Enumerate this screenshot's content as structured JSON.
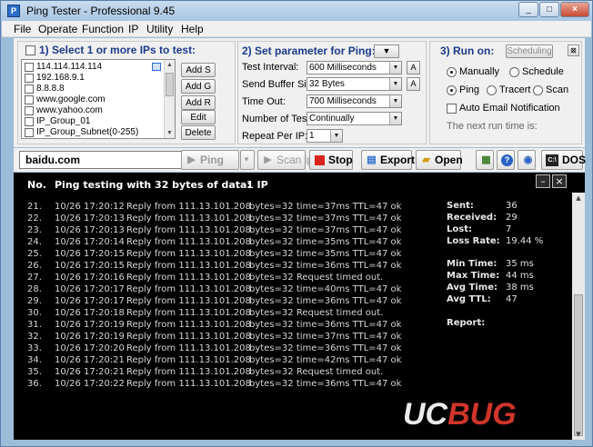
{
  "window": {
    "title": "Ping Tester - Professional  9.45",
    "minimize": "_",
    "maximize": "□",
    "close": "×"
  },
  "menu": [
    "File",
    "Operate",
    "Function",
    "IP",
    "Utility",
    "Help"
  ],
  "section1": {
    "title": "1) Select 1 or more IPs to test:",
    "items": [
      {
        "label": "114.114.114.114",
        "checked": false
      },
      {
        "label": "192.168.9.1",
        "checked": false
      },
      {
        "label": "8.8.8.8",
        "checked": false
      },
      {
        "label": "www.google.com",
        "checked": false
      },
      {
        "label": "www.yahoo.com",
        "checked": false
      },
      {
        "label": "IP_Group_01",
        "checked": false
      },
      {
        "label": "IP_Group_Subnet(0-255)",
        "checked": false
      }
    ],
    "buttons": [
      "Add S",
      "Add G",
      "Add R",
      "Edit",
      "Delete"
    ]
  },
  "section2": {
    "title": "2) Set parameter for Ping:",
    "fields": [
      {
        "label": "Test Interval:",
        "value": "600  Milliseconds",
        "has_a": true
      },
      {
        "label": "Send Buffer Size:",
        "value": "32  Bytes",
        "has_a": true
      },
      {
        "label": "Time Out:",
        "value": "700  Milliseconds",
        "has_a": false
      },
      {
        "label": "Number of Test:",
        "value": "Continually",
        "has_a": false
      },
      {
        "label": "Repeat Per IP:",
        "value": "1",
        "has_a": false
      }
    ],
    "a_label": "A"
  },
  "section3": {
    "title": "3) Run on:",
    "scheduling_label": "Scheduling",
    "run_options": [
      {
        "label": "Manually",
        "selected": true
      },
      {
        "label": "Schedule",
        "selected": false
      }
    ],
    "method_options": [
      {
        "label": "Ping",
        "selected": true
      },
      {
        "label": "Tracert",
        "selected": false
      },
      {
        "label": "Scan",
        "selected": false
      }
    ],
    "auto_email": "Auto Email Notification",
    "next_run": "The next run time is:"
  },
  "toolbar": {
    "target": "baidu.com",
    "ping": "Ping",
    "scan_ip": "Scan ip",
    "stop": "Stop",
    "export": "Export",
    "open": "Open",
    "dos": "DOS"
  },
  "console": {
    "header_no": "No.",
    "header_text": "Ping testing with 32 bytes of data:",
    "header_ip": "1  IP",
    "rows": [
      {
        "no": "21.",
        "time": "10/26 17:20:12",
        "from": "Reply from 111.13.101.208",
        "msg": "bytes=32  time=37ms  TTL=47  ok"
      },
      {
        "no": "22.",
        "time": "10/26 17:20:13",
        "from": "Reply from 111.13.101.208",
        "msg": "bytes=32  time=37ms  TTL=47  ok"
      },
      {
        "no": "23.",
        "time": "10/26 17:20:13",
        "from": "Reply from 111.13.101.208",
        "msg": "bytes=32  time=37ms  TTL=47  ok"
      },
      {
        "no": "24.",
        "time": "10/26 17:20:14",
        "from": "Reply from 111.13.101.208",
        "msg": "bytes=32  time=35ms  TTL=47  ok"
      },
      {
        "no": "25.",
        "time": "10/26 17:20:15",
        "from": "Reply from 111.13.101.208",
        "msg": "bytes=32  time=35ms  TTL=47  ok"
      },
      {
        "no": "26.",
        "time": "10/26 17:20:15",
        "from": "Reply from 111.13.101.208",
        "msg": "bytes=32  time=36ms  TTL=47  ok"
      },
      {
        "no": "27.",
        "time": "10/26 17:20:16",
        "from": "Reply from 111.13.101.208",
        "msg": "bytes=32  Request  timed  out."
      },
      {
        "no": "28.",
        "time": "10/26 17:20:17",
        "from": "Reply from 111.13.101.208",
        "msg": "bytes=32  time=40ms  TTL=47  ok"
      },
      {
        "no": "29.",
        "time": "10/26 17:20:17",
        "from": "Reply from 111.13.101.208",
        "msg": "bytes=32  time=36ms  TTL=47  ok"
      },
      {
        "no": "30.",
        "time": "10/26 17:20:18",
        "from": "Reply from 111.13.101.208",
        "msg": "bytes=32  Request  timed  out."
      },
      {
        "no": "31.",
        "time": "10/26 17:20:19",
        "from": "Reply from 111.13.101.208",
        "msg": "bytes=32  time=36ms  TTL=47  ok"
      },
      {
        "no": "32.",
        "time": "10/26 17:20:19",
        "from": "Reply from 111.13.101.208",
        "msg": "bytes=32  time=37ms  TTL=47  ok"
      },
      {
        "no": "33.",
        "time": "10/26 17:20:20",
        "from": "Reply from 111.13.101.208",
        "msg": "bytes=32  time=36ms  TTL=47  ok"
      },
      {
        "no": "34.",
        "time": "10/26 17:20:21",
        "from": "Reply from 111.13.101.208",
        "msg": "bytes=32  time=42ms  TTL=47  ok"
      },
      {
        "no": "35.",
        "time": "10/26 17:20:21",
        "from": "Reply from 111.13.101.208",
        "msg": "bytes=32  Request  timed  out."
      },
      {
        "no": "36.",
        "time": "10/26 17:20:22",
        "from": "Reply from 111.13.101.208",
        "msg": "bytes=32  time=36ms  TTL=47  ok"
      }
    ],
    "stats": [
      {
        "label": "Sent:",
        "value": "36"
      },
      {
        "label": "Received:",
        "value": "29"
      },
      {
        "label": "Lost:",
        "value": "7"
      },
      {
        "label": "Loss Rate:",
        "value": "19.44 %"
      },
      {
        "label": "Min Time:",
        "value": "35 ms"
      },
      {
        "label": "Max Time:",
        "value": "44 ms"
      },
      {
        "label": "Avg Time:",
        "value": "38 ms"
      },
      {
        "label": "Avg TTL:",
        "value": "47"
      },
      {
        "label": "Report:",
        "value": ""
      }
    ]
  },
  "watermark": {
    "part1": "UC",
    "part2": "BUG"
  },
  "colors": {
    "accent": "#1a3a8a",
    "console_bg": "#000000",
    "stop_red": "#d9241b"
  }
}
